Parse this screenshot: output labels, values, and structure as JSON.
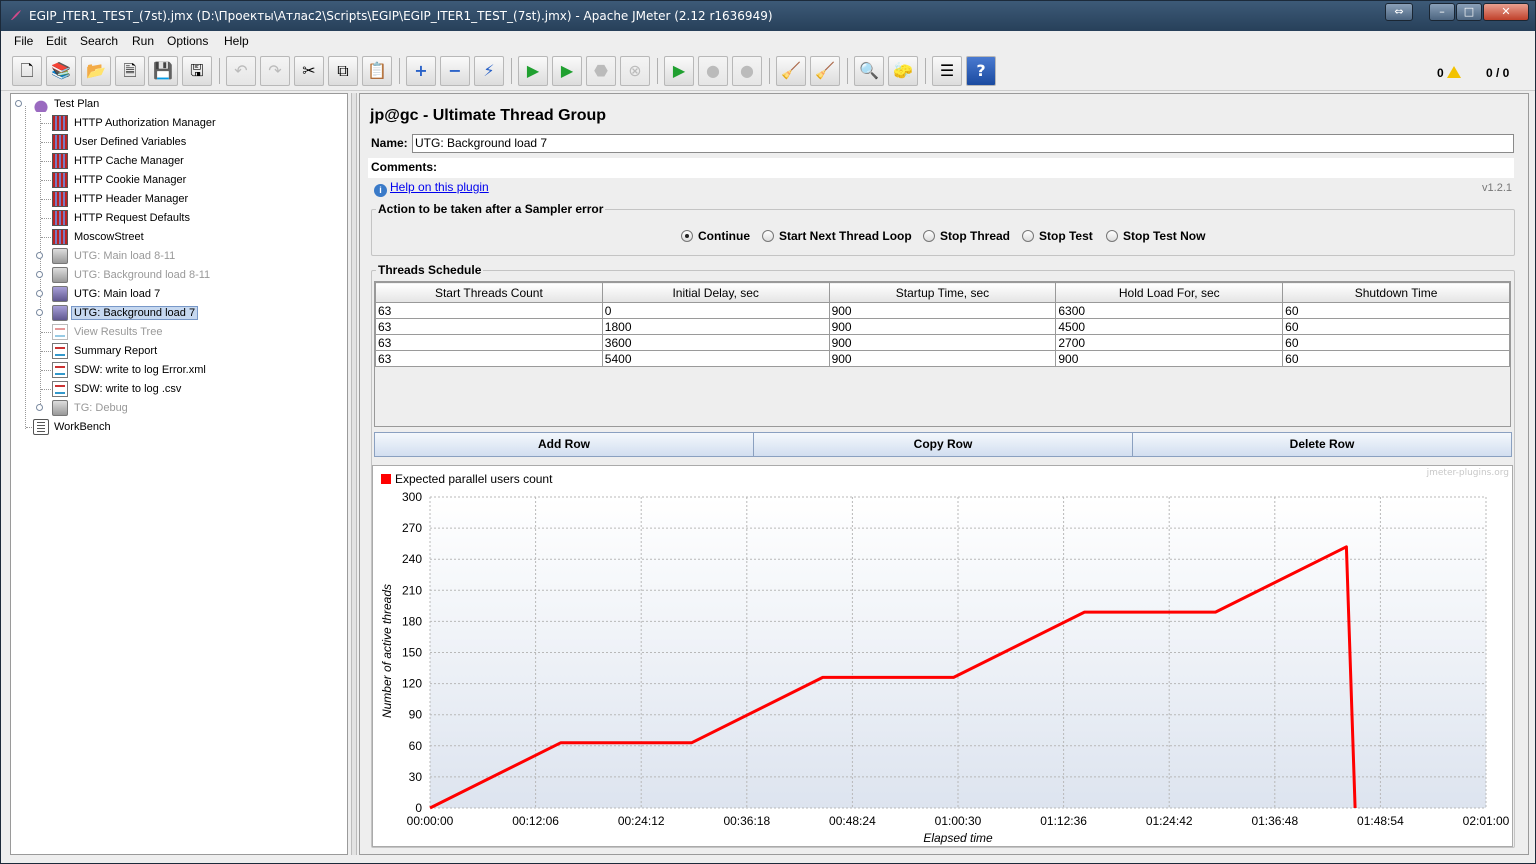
{
  "window": {
    "title": "EGIP_ITER1_TEST_(7st).jmx (D:\\Проекты\\Атлас2\\Scripts\\EGIP\\EGIP_ITER1_TEST_(7st).jmx) - Apache JMeter (2.12 r1636949)",
    "btn_restore": "⇔",
    "btn_min": "–",
    "btn_max": "□",
    "btn_close": "✕"
  },
  "menu": {
    "file": "File",
    "edit": "Edit",
    "search": "Search",
    "run": "Run",
    "options": "Options",
    "help": "Help"
  },
  "toolbar": {
    "warnings": "0",
    "threads": "0 / 0"
  },
  "tree": {
    "nodes": [
      {
        "label": "Test Plan"
      },
      {
        "label": "HTTP Authorization Manager"
      },
      {
        "label": "User Defined Variables"
      },
      {
        "label": "HTTP Cache Manager"
      },
      {
        "label": "HTTP Cookie Manager"
      },
      {
        "label": "HTTP Header Manager"
      },
      {
        "label": "HTTP Request Defaults"
      },
      {
        "label": "MoscowStreet"
      },
      {
        "label": "UTG: Main load 8-11"
      },
      {
        "label": "UTG: Background load 8-11"
      },
      {
        "label": "UTG: Main load 7"
      },
      {
        "label": "UTG: Background load 7"
      },
      {
        "label": "View Results Tree"
      },
      {
        "label": "Summary Report"
      },
      {
        "label": "SDW: write to log Error.xml"
      },
      {
        "label": "SDW: write to log .csv"
      },
      {
        "label": "TG: Debug"
      },
      {
        "label": "WorkBench"
      }
    ]
  },
  "panel": {
    "title": "jp@gc - Ultimate Thread Group",
    "name_label": "Name:",
    "name_value": "UTG: Background load 7",
    "comments_label": "Comments:",
    "help_link": "Help on this plugin",
    "version": "v1.2.1",
    "error_group_title": "Action to be taken after a Sampler error",
    "error_actions": [
      "Continue",
      "Start Next Thread Loop",
      "Stop Thread",
      "Stop Test",
      "Stop Test Now"
    ],
    "error_selected": "Continue",
    "schedule_title": "Threads Schedule",
    "columns": [
      "Start Threads Count",
      "Initial Delay, sec",
      "Startup Time, sec",
      "Hold Load For, sec",
      "Shutdown Time"
    ],
    "rows": [
      [
        "63",
        "0",
        "900",
        "6300",
        "60"
      ],
      [
        "63",
        "1800",
        "900",
        "4500",
        "60"
      ],
      [
        "63",
        "3600",
        "900",
        "2700",
        "60"
      ],
      [
        "63",
        "5400",
        "900",
        "900",
        "60"
      ]
    ],
    "btn_add": "Add Row",
    "btn_copy": "Copy Row",
    "btn_delete": "Delete Row"
  },
  "chart_data": {
    "type": "line",
    "watermark": "jmeter-plugins.org",
    "legend": "Expected parallel users count",
    "legend_color": "#ff0000",
    "xlabel": "Elapsed time",
    "ylabel": "Number of active threads",
    "yticks": [
      "300",
      "270",
      "240",
      "210",
      "180",
      "150",
      "120",
      "90",
      "60",
      "30",
      "0"
    ],
    "xticks": [
      "00:00:00",
      "00:12:06",
      "00:24:12",
      "00:36:18",
      "00:48:24",
      "01:00:30",
      "01:12:36",
      "01:24:42",
      "01:36:48",
      "01:48:54",
      "02:01:00"
    ],
    "ylim": [
      0,
      300
    ],
    "xlim_sec": [
      0,
      7260
    ],
    "grid": true,
    "series": [
      {
        "name": "Expected parallel users count",
        "x_sec": [
          0,
          900,
          1800,
          2700,
          3600,
          4500,
          5400,
          6300,
          6300,
          6360
        ],
        "y": [
          0,
          63,
          63,
          126,
          126,
          189,
          189,
          252,
          252,
          0
        ]
      }
    ]
  }
}
